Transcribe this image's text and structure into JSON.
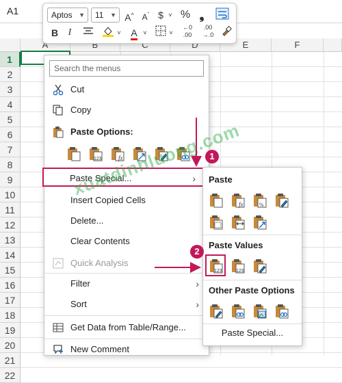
{
  "namebox": {
    "cell_ref": "A1"
  },
  "grid": {
    "columns": [
      "A",
      "B",
      "C",
      "D",
      "E",
      "F"
    ],
    "rows": [
      "1",
      "2",
      "3",
      "4",
      "5",
      "6",
      "7",
      "8",
      "9",
      "10",
      "11",
      "12",
      "13",
      "14",
      "15",
      "16",
      "17",
      "18",
      "19",
      "20",
      "21",
      "22"
    ],
    "selected_cell": "A1"
  },
  "minibar": {
    "font_name": "Aptos",
    "font_size": "11",
    "grow_font_glyph": "A",
    "shrink_font_glyph": "A",
    "currency_glyph": "$",
    "percent_glyph": "%",
    "comma_glyph": "❟",
    "bold_glyph": "B",
    "italic_glyph": "I",
    "font_color_glyph": "A",
    "font_color": "#e21b1b",
    "highlight_color": "#ffd400",
    "increase_decimal_top": "←0",
    "increase_decimal_bottom": ".00",
    "decrease_decimal_top": ".00",
    "decrease_decimal_bottom": "→.0"
  },
  "context_menu": {
    "search_placeholder": "Search the menus",
    "items": [
      {
        "label": "Cut",
        "icon": "scissors-icon"
      },
      {
        "label": "Copy",
        "icon": "copy-icon"
      },
      {
        "label": "Paste Options:",
        "icon": "clipboard-icon"
      },
      {
        "label": "Paste Special...",
        "icon": ""
      },
      {
        "label": "Insert Copied Cells",
        "icon": ""
      },
      {
        "label": "Delete...",
        "icon": ""
      },
      {
        "label": "Clear Contents",
        "icon": ""
      },
      {
        "label": "Quick Analysis",
        "icon": "quick-analysis-icon"
      },
      {
        "label": "Filter",
        "icon": ""
      },
      {
        "label": "Sort",
        "icon": ""
      },
      {
        "label": "Get Data from Table/Range...",
        "icon": "table-icon"
      },
      {
        "label": "New Comment",
        "icon": "new-comment-icon"
      }
    ],
    "arrow_glyph": "›"
  },
  "submenu": {
    "paste_header": "Paste",
    "paste_values_header": "Paste Values",
    "other_header": "Other Paste Options",
    "paste_special_label": "Paste Special..."
  },
  "callouts": {
    "badge1": "1",
    "badge2": "2"
  },
  "watermark": "xuatdinhluong.com",
  "colors": {
    "accent": "#c2185b",
    "excel_green": "#137e43"
  }
}
